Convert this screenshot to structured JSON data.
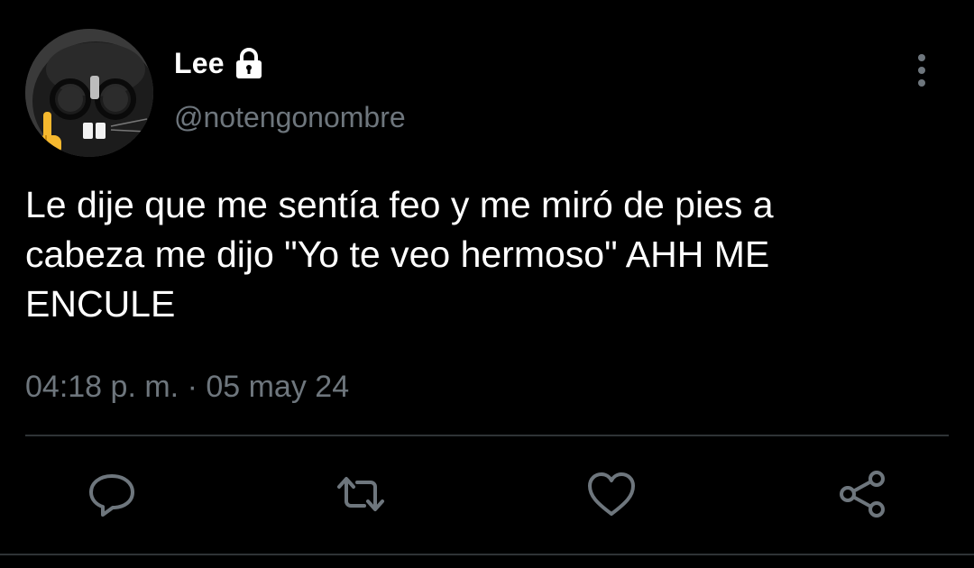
{
  "author": {
    "display_name": "Lee",
    "handle": "@notengonombre",
    "protected": true,
    "avatar_icon": "cat-with-glasses-avatar",
    "lock_icon": "lock-icon"
  },
  "tweet": {
    "text_lines": [
      "Le dije que me sentía feo y me miró de pies a",
      "cabeza me dijo \"Yo te veo hermoso\" AHH ME",
      "ENCULE"
    ],
    "time": "04:18 p. m.",
    "separator": "·",
    "date": "05 may 24"
  },
  "actions": {
    "reply_icon": "reply-icon",
    "retweet_icon": "retweet-icon",
    "like_icon": "heart-icon",
    "share_icon": "share-icon",
    "more_icon": "more-vertical-icon"
  },
  "colors": {
    "background": "#000000",
    "primary_text": "#ffffff",
    "secondary_text": "#6e767d",
    "divider": "#2f3336"
  }
}
